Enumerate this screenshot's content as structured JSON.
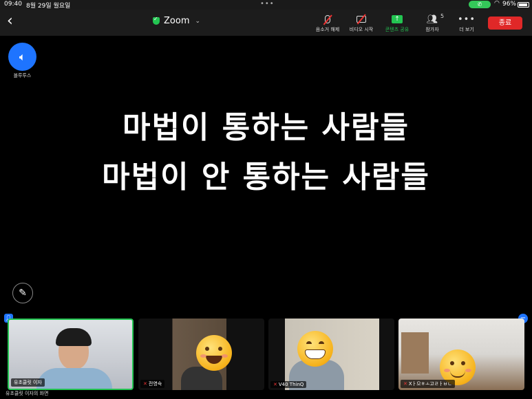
{
  "status_bar": {
    "time": "09:40",
    "date": "8월 29일 월요일",
    "battery": "96%"
  },
  "toolbar": {
    "title": "Zoom",
    "buttons": [
      {
        "label": "음소거 해제",
        "icon": "mic-off-icon"
      },
      {
        "label": "비디오 시작",
        "icon": "camera-off-icon"
      },
      {
        "label": "콘텐츠 공유",
        "icon": "share-screen-icon"
      },
      {
        "label": "참가자",
        "icon": "participants-icon"
      },
      {
        "label": "더 보기",
        "icon": "more-icon"
      }
    ],
    "participants_count": "5",
    "end_label": "종료"
  },
  "audio": {
    "label": "블루투스"
  },
  "shared_content": {
    "line1": "마법이 통하는 사람들",
    "line2": "마법이 안 통하는 사람들"
  },
  "thumbnails": [
    {
      "name": "유초클릿 이자",
      "muted": false
    },
    {
      "name": "전영숙",
      "muted": true
    },
    {
      "name": "V40 ThinQ",
      "muted": true
    },
    {
      "name": "Xㅏ으ㅎㅗ고ㄹㅏㅂㄴ",
      "muted": true
    }
  ],
  "screen_share_label": "유초클릿 이자의 화면",
  "colors": {
    "accent_green": "#23c552",
    "end_red": "#e02828",
    "blue": "#1e74ff"
  }
}
